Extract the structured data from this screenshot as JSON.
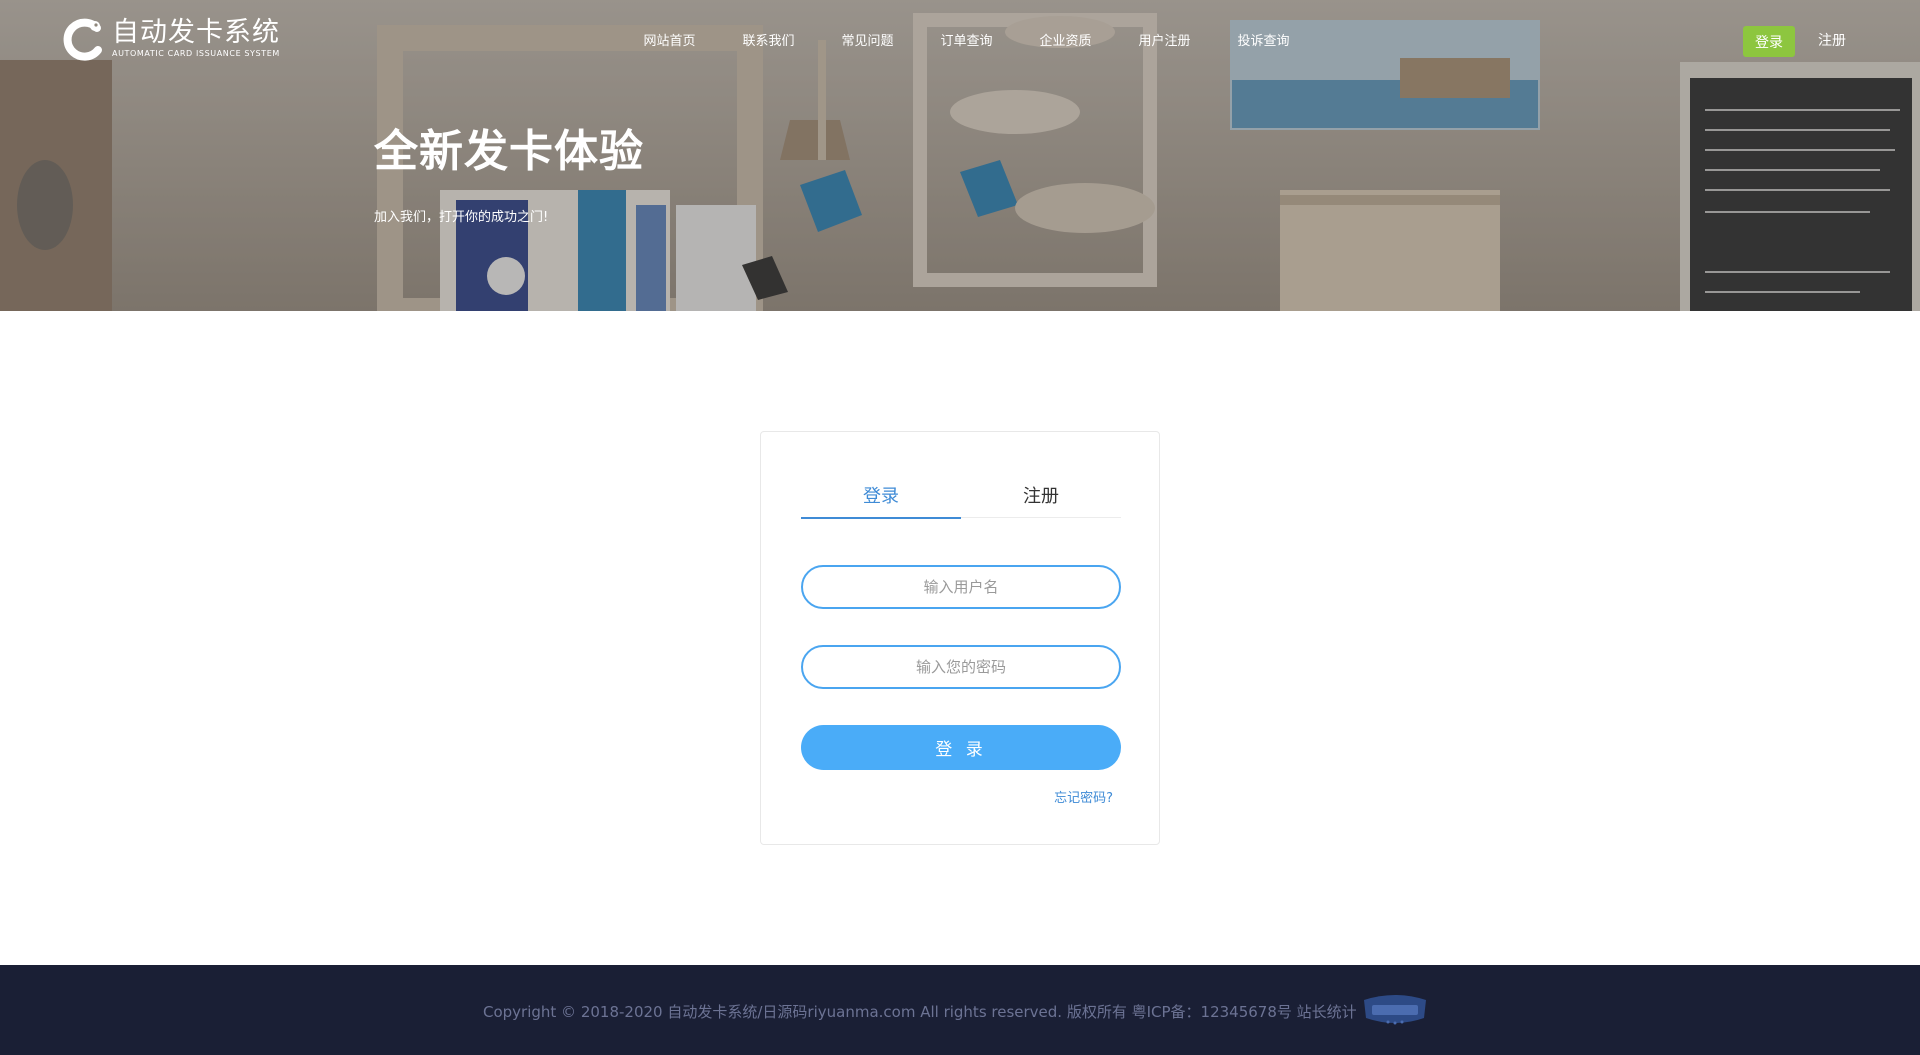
{
  "header": {
    "logo": {
      "title": "自动发卡系统",
      "subtitle": "AUTOMATIC CARD ISSUANCE SYSTEM"
    },
    "nav": [
      {
        "label": "网站首页"
      },
      {
        "label": "联系我们"
      },
      {
        "label": "常见问题"
      },
      {
        "label": "订单查询"
      },
      {
        "label": "企业资质"
      },
      {
        "label": "用户注册"
      },
      {
        "label": "投诉查询"
      }
    ],
    "login_label": "登录",
    "register_label": "注册",
    "login_button_color": "#8dc63f"
  },
  "hero": {
    "title": "全新发卡体验",
    "subtitle": "加入我们，打开你的成功之门!"
  },
  "login_card": {
    "tabs": [
      {
        "label": "登录",
        "active": true
      },
      {
        "label": "注册",
        "active": false
      }
    ],
    "username": {
      "value": "",
      "placeholder": "输入用户名"
    },
    "password": {
      "value": "",
      "placeholder": "输入您的密码"
    },
    "submit_label": "登 录",
    "forgot_label": "忘记密码?",
    "accent_color": "#4aacf8"
  },
  "footer": {
    "copyright": "Copyright © 2018-2020 自动发卡系统/日源码riyuanma.com All rights reserved. 版权所有 粤ICP备：12345678号 站长统计",
    "badge_icon": "verified-seal-icon",
    "background_color": "#1a1f35"
  }
}
